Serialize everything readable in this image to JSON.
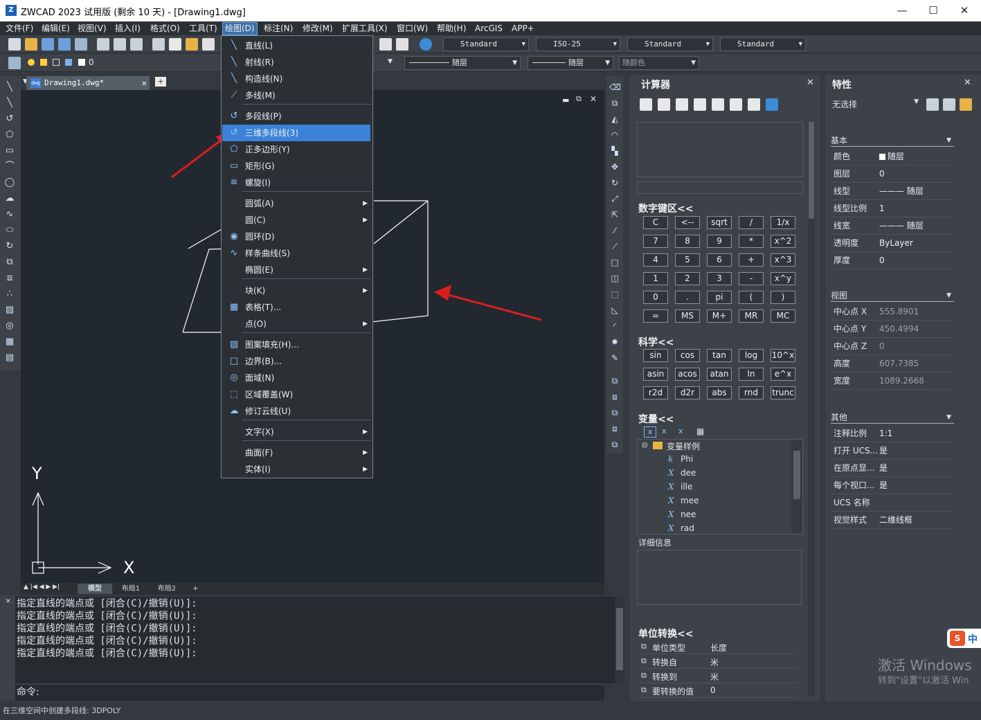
{
  "window": {
    "title": "ZWCAD 2023 试用版 (剩余 10 天) - [Drawing1.dwg]",
    "logo_text": "Z",
    "minimize": "—",
    "maximize": "☐",
    "close": "✕"
  },
  "menubar": [
    "文件(F)",
    "编辑(E)",
    "视图(V)",
    "插入(I)",
    "格式(O)",
    "工具(T)",
    "绘图(D)",
    "标注(N)",
    "修改(M)",
    "扩展工具(X)",
    "窗口(W)",
    "帮助(H)",
    "ArcGIS",
    "APP+"
  ],
  "toolbar": {
    "text_style": "Standard",
    "dim_style": "ISO-25",
    "table_style": "Standard",
    "mleader_style": "Standard",
    "layer_value": "0",
    "linetype1": "随层",
    "linetype2": "随层",
    "color": "随颜色"
  },
  "doc_tab": {
    "name": "Drawing1.dwg*",
    "close": "✕",
    "new": "+"
  },
  "draw_menu": [
    {
      "label": "直线(L)",
      "icon": "line-icon",
      "glyph": "╲"
    },
    {
      "label": "射线(R)",
      "icon": "ray-icon",
      "glyph": "╲"
    },
    {
      "label": "构造线(N)",
      "icon": "xline-icon",
      "glyph": "╲"
    },
    {
      "label": "多线(M)",
      "icon": "mline-icon",
      "glyph": "⟋"
    },
    {
      "label": "多段线(P)",
      "icon": "pline-icon",
      "glyph": "↺"
    },
    {
      "label": "三维多段线(3)",
      "icon": "3dpoly-icon",
      "glyph": "↺"
    },
    {
      "label": "正多边形(Y)",
      "icon": "polygon-icon",
      "glyph": "⬠"
    },
    {
      "label": "矩形(G)",
      "icon": "rectangle-icon",
      "glyph": "▭"
    },
    {
      "label": "螺旋(I)",
      "icon": "helix-icon",
      "glyph": "≋"
    },
    {
      "label": "圆弧(A)",
      "icon": "",
      "glyph": ""
    },
    {
      "label": "圆(C)",
      "icon": "",
      "glyph": ""
    },
    {
      "label": "圆环(D)",
      "icon": "donut-icon",
      "glyph": "◉"
    },
    {
      "label": "样条曲线(S)",
      "icon": "spline-icon",
      "glyph": "∿"
    },
    {
      "label": "椭圆(E)",
      "icon": "",
      "glyph": ""
    },
    {
      "label": "块(K)",
      "icon": "",
      "glyph": ""
    },
    {
      "label": "表格(T)...",
      "icon": "table-icon",
      "glyph": "▦"
    },
    {
      "label": "点(O)",
      "icon": "",
      "glyph": ""
    },
    {
      "label": "图案填充(H)...",
      "icon": "hatch-icon",
      "glyph": "▨"
    },
    {
      "label": "边界(B)...",
      "icon": "boundary-icon",
      "glyph": "□"
    },
    {
      "label": "面域(N)",
      "icon": "region-icon",
      "glyph": "◎"
    },
    {
      "label": "区域覆盖(W)",
      "icon": "wipeout-icon",
      "glyph": "⬚"
    },
    {
      "label": "修订云线(U)",
      "icon": "revcloud-icon",
      "glyph": "☁"
    },
    {
      "label": "文字(X)",
      "icon": "",
      "glyph": ""
    },
    {
      "label": "曲面(F)",
      "icon": "",
      "glyph": ""
    },
    {
      "label": "实体(I)",
      "icon": "",
      "glyph": ""
    }
  ],
  "layout_tabs": [
    "模型",
    "布局1",
    "布局2",
    "+"
  ],
  "command_history": [
    "指定直线的端点或 [闭合(C)/撤销(U)]:",
    "指定直线的端点或 [闭合(C)/撤销(U)]:",
    "指定直线的端点或 [闭合(C)/撤销(U)]:",
    "指定直线的端点或 [闭合(C)/撤销(U)]:",
    "指定直线的端点或 [闭合(C)/撤销(U)]:"
  ],
  "command_prompt": "命令:",
  "status_text": "在三维空间中创建多段线: 3DPOLY",
  "ucs": {
    "x": "X",
    "y": "Y"
  },
  "calculator": {
    "title": "计算器",
    "numpad_title": "数字键区<<",
    "numpad": [
      [
        "C",
        "<--",
        "sqrt",
        "/",
        "1/x"
      ],
      [
        "7",
        "8",
        "9",
        "*",
        "x^2"
      ],
      [
        "4",
        "5",
        "6",
        "+",
        "x^3"
      ],
      [
        "1",
        "2",
        "3",
        "-",
        "x^y"
      ],
      [
        "0",
        ".",
        "pi",
        "(",
        ")"
      ],
      [
        "=",
        "MS",
        "M+",
        "MR",
        "MC"
      ]
    ],
    "sci_title": "科学<<",
    "sci": [
      [
        "sin",
        "cos",
        "tan",
        "log",
        "10^x"
      ],
      [
        "asin",
        "acos",
        "atan",
        "ln",
        "e^x"
      ],
      [
        "r2d",
        "d2r",
        "abs",
        "rnd",
        "trunc"
      ]
    ],
    "var_title": "变量<<",
    "var_root": "变量样例",
    "vars": [
      {
        "sym": "k",
        "name": "Phi"
      },
      {
        "sym": "X",
        "name": "dee"
      },
      {
        "sym": "X",
        "name": "ille"
      },
      {
        "sym": "X",
        "name": "mee"
      },
      {
        "sym": "X",
        "name": "nee"
      },
      {
        "sym": "X",
        "name": "rad"
      }
    ],
    "detail_title": "详细信息",
    "unit_title": "单位转换<<",
    "units": [
      {
        "k": "单位类型",
        "v": "长度"
      },
      {
        "k": "转换自",
        "v": "米"
      },
      {
        "k": "转换到",
        "v": "米"
      },
      {
        "k": "要转换的值",
        "v": "0"
      }
    ]
  },
  "properties": {
    "title": "特性",
    "selection": "无选择",
    "basic_title": "基本",
    "basic": [
      {
        "k": "颜色",
        "v": "随层"
      },
      {
        "k": "图层",
        "v": "0"
      },
      {
        "k": "线型",
        "v": "——— 随层"
      },
      {
        "k": "线型比例",
        "v": "1"
      },
      {
        "k": "线宽",
        "v": "——— 随层"
      },
      {
        "k": "透明度",
        "v": "ByLayer"
      },
      {
        "k": "厚度",
        "v": "0"
      }
    ],
    "view_title": "视图",
    "view": [
      {
        "k": "中心点 X",
        "v": "555.8901"
      },
      {
        "k": "中心点 Y",
        "v": "450.4994"
      },
      {
        "k": "中心点 Z",
        "v": "0"
      },
      {
        "k": "高度",
        "v": "607.7385"
      },
      {
        "k": "宽度",
        "v": "1089.2668"
      }
    ],
    "other_title": "其他",
    "other": [
      {
        "k": "注释比例",
        "v": "1:1"
      },
      {
        "k": "打开 UCS...",
        "v": "是"
      },
      {
        "k": "在原点显...",
        "v": "是"
      },
      {
        "k": "每个视口...",
        "v": "是"
      },
      {
        "k": "UCS 名称",
        "v": ""
      },
      {
        "k": "视觉样式",
        "v": "二维线框"
      }
    ]
  },
  "watermark": {
    "line1": "激活 Windows",
    "line2": "转到\"设置\"以激活 Win"
  },
  "badge": {
    "s": "S",
    "text": "中"
  }
}
